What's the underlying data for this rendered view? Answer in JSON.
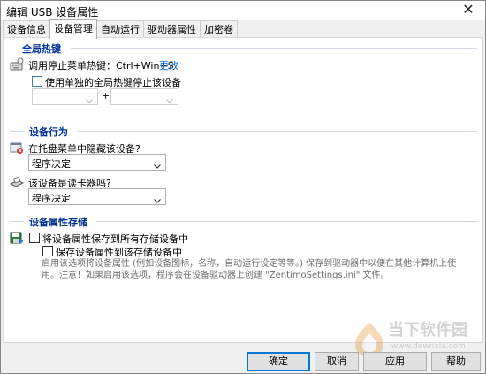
{
  "window": {
    "title": "编辑 USB 设备属性",
    "close_glyph": "✕"
  },
  "tabs": [
    {
      "label": "设备信息"
    },
    {
      "label": "设备管理"
    },
    {
      "label": "自动运行"
    },
    {
      "label": "驱动器属性"
    },
    {
      "label": "加密卷"
    }
  ],
  "active_tab": "设备管理",
  "global_hotkey": {
    "title": "全局热键",
    "menu_hotkey_label": "调用停止菜单热键：Ctrl+Win+S",
    "change_link": "更改",
    "use_individual_label": "使用单独的全局热键停止该设备",
    "plus": "+",
    "left_select_value": "",
    "right_select_value": ""
  },
  "device_behavior": {
    "title": "设备行为",
    "hide_label": "在托盘菜单中隐藏该设备?",
    "hide_value": "程序决定",
    "reader_label": "该设备是读卡器吗?",
    "reader_value": "程序决定"
  },
  "property_storage": {
    "title": "设备属性存储",
    "save_all_label": "将设备属性保存到所有存储设备中",
    "save_this_label": "保存设备属性到该存储设备中",
    "description": "启用该选项将设备属性 (例如设备图标，名称，自动运行设定等等。) 保存到驱动器中以便在其他计算机上使用。注意！如果启用该选项，程序会在设备驱动器上创建 \"ZentimoSettings.ini\" 文件。"
  },
  "buttons": {
    "ok": "确定",
    "cancel": "取消",
    "apply": "应用",
    "help": "帮助"
  },
  "watermark": {
    "text": "当下软件园",
    "url": "www.downxia.com"
  },
  "colors": {
    "section_title": "#003399",
    "link": "#0066cc",
    "accent": "#0078d7"
  }
}
